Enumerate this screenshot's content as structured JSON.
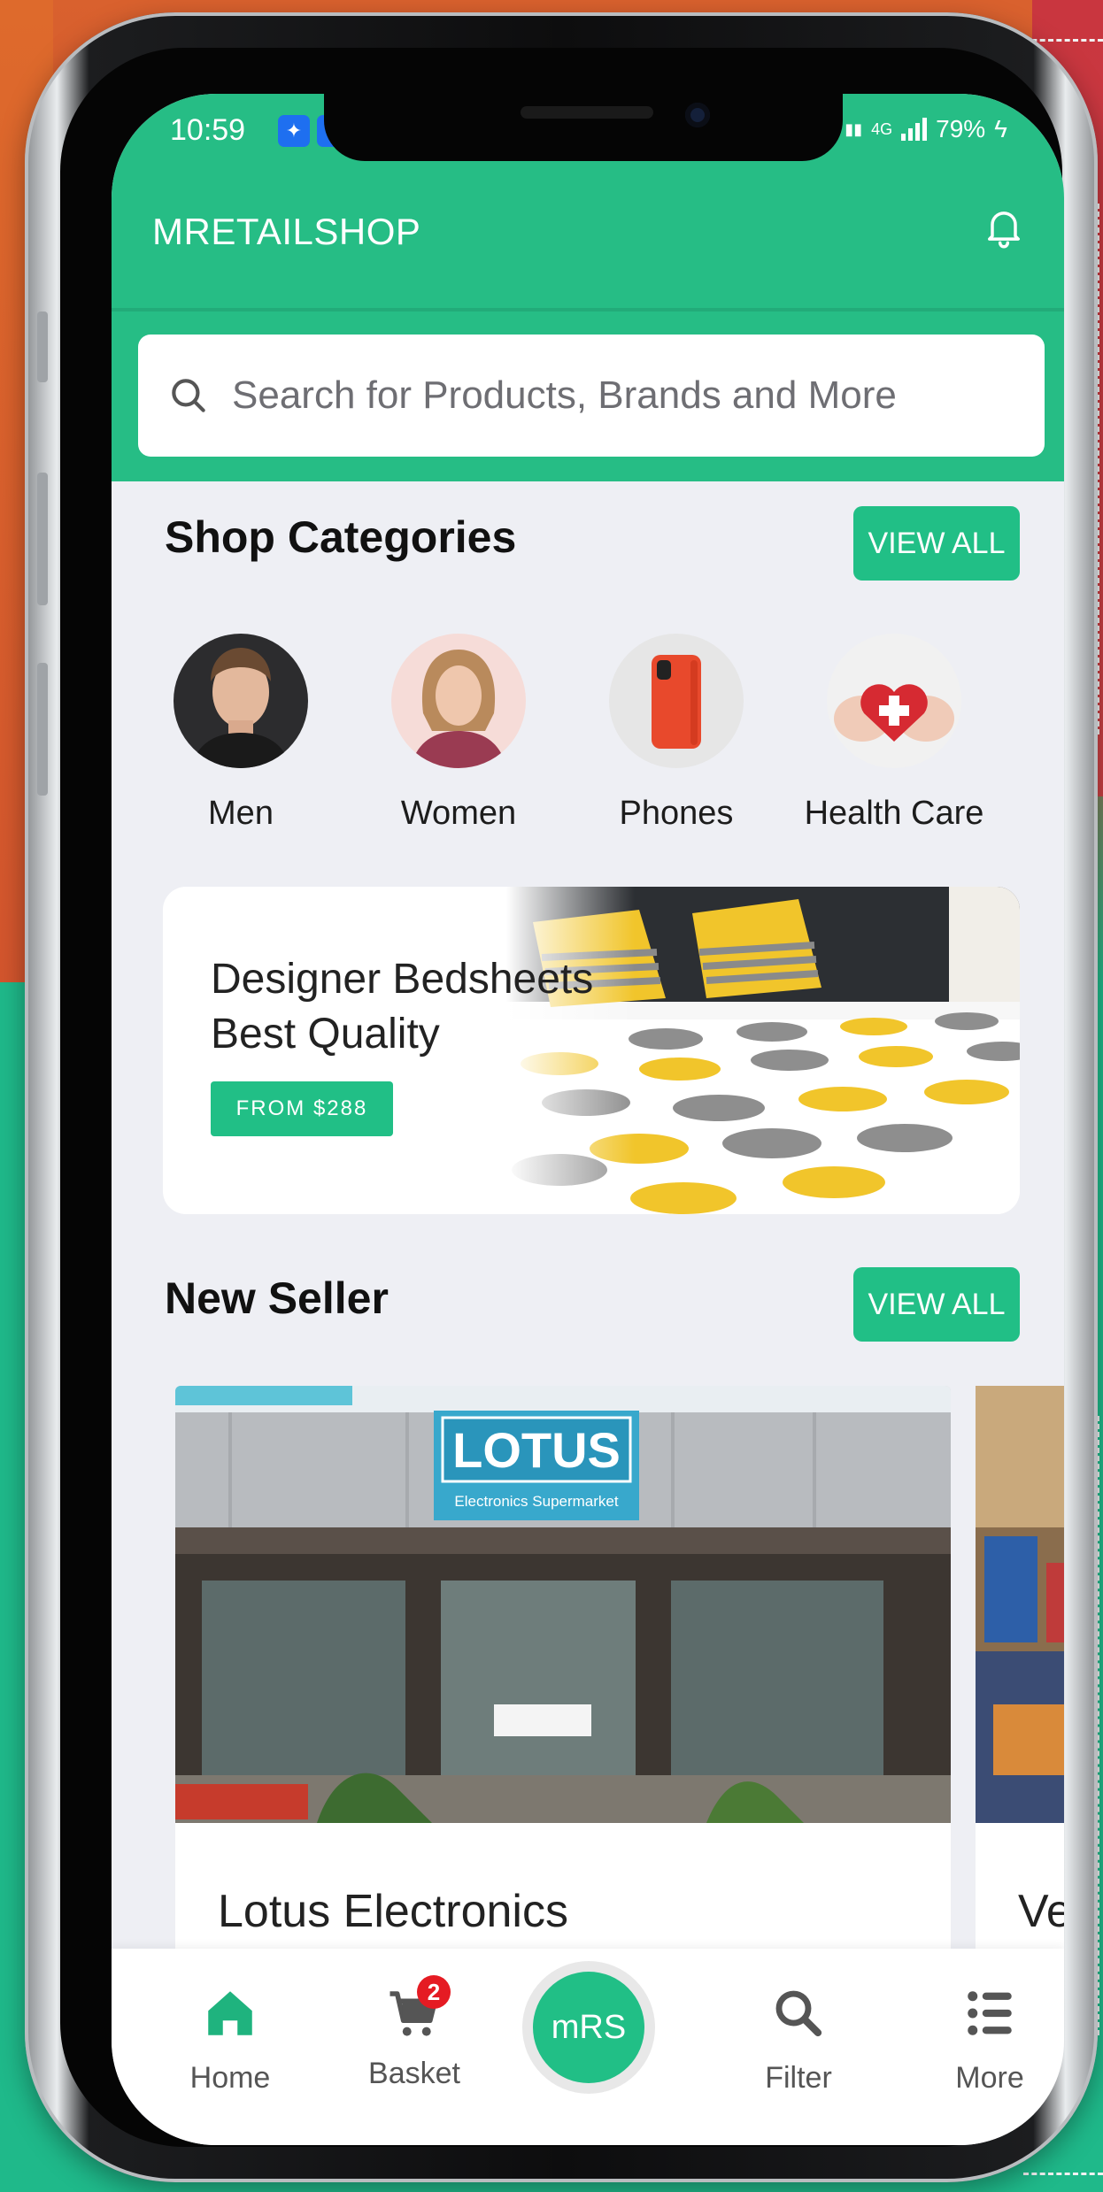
{
  "status_bar": {
    "time": "10:59",
    "battery": "79%",
    "network": "4G"
  },
  "header": {
    "app_title": "MRETAILSHOP",
    "search_placeholder": "Search for Products, Brands and More"
  },
  "shop_categories": {
    "title": "Shop Categories",
    "view_all_label": "VIEW ALL",
    "items": [
      {
        "label": "Men",
        "icon": "man-portrait"
      },
      {
        "label": "Women",
        "icon": "woman-portrait"
      },
      {
        "label": "Phones",
        "icon": "phone-image"
      },
      {
        "label": "Health Care",
        "icon": "health-care-image"
      }
    ]
  },
  "banner": {
    "line1": "Designer Bedsheets",
    "line2": "Best Quality",
    "button_label": "FROM $288"
  },
  "new_seller": {
    "title": "New Seller",
    "view_all_label": "VIEW ALL",
    "sellers": [
      {
        "name": "Lotus Electronics",
        "sign_text": "LOTUS",
        "sign_subtext": "Electronics Supermarket"
      },
      {
        "name": "Ve"
      }
    ]
  },
  "bottom_nav": {
    "home_label": "Home",
    "basket_label": "Basket",
    "basket_count": "2",
    "center_label": "mRS",
    "filter_label": "Filter",
    "more_label": "More"
  },
  "colors": {
    "brand_green": "#26bd85",
    "badge_red": "#e51b23",
    "screen_bg": "#eeeff4"
  }
}
